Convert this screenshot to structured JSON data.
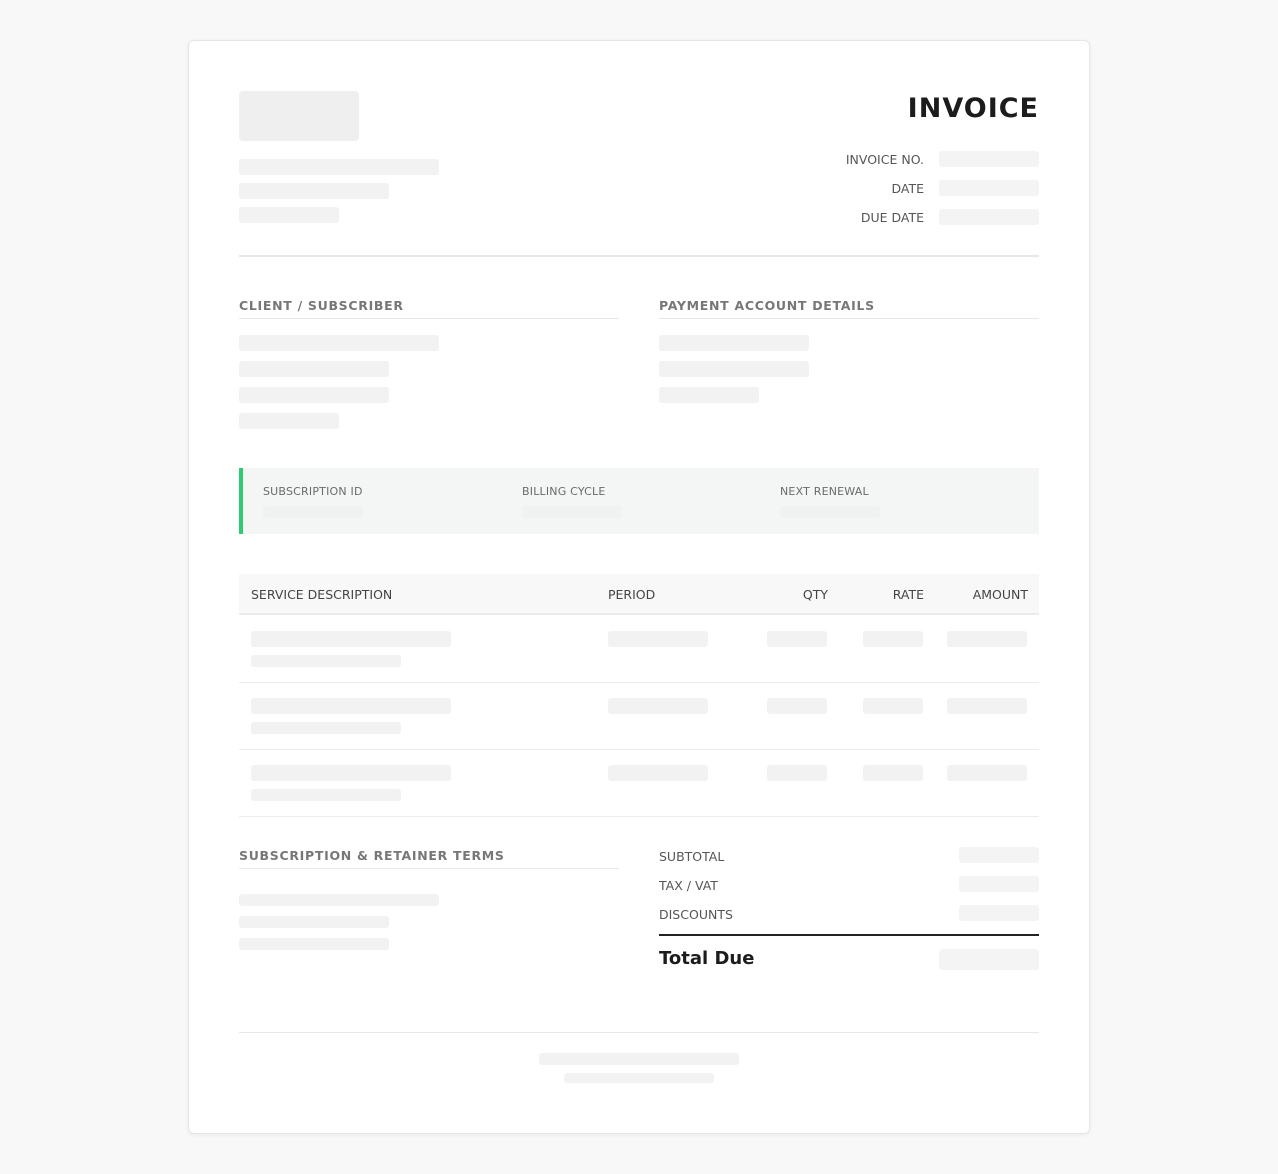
{
  "header": {
    "title": "INVOICE",
    "meta_labels": {
      "invoice_no": "INVOICE NO.",
      "date": "DATE",
      "due_date": "DUE DATE"
    }
  },
  "sections": {
    "client": "CLIENT / SUBSCRIBER",
    "payment": "PAYMENT ACCOUNT DETAILS",
    "terms": "SUBSCRIPTION & RETAINER TERMS"
  },
  "subscription": {
    "id_label": "SUBSCRIPTION ID",
    "cycle_label": "BILLING CYCLE",
    "renewal_label": "NEXT RENEWAL",
    "accent_color": "#2ecc71"
  },
  "table": {
    "columns": [
      "SERVICE DESCRIPTION",
      "PERIOD",
      "QTY",
      "RATE",
      "AMOUNT"
    ],
    "row_count": 3
  },
  "totals": {
    "subtotal": "SUBTOTAL",
    "tax": "TAX / VAT",
    "discounts": "DISCOUNTS",
    "total_due": "Total Due"
  }
}
